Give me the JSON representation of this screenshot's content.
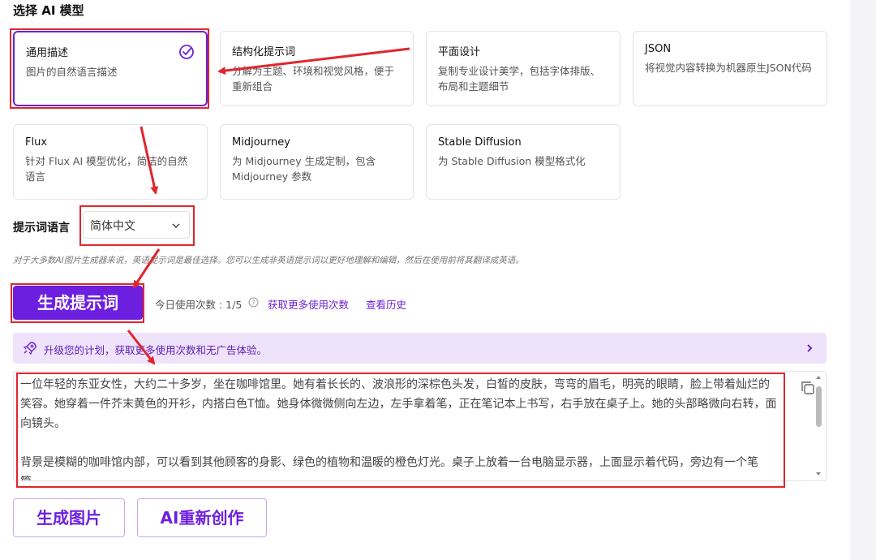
{
  "section": {
    "title": "选择 AI 模型"
  },
  "models": [
    {
      "title": "通用描述",
      "desc": "图片的自然语言描述"
    },
    {
      "title": "结构化提示词",
      "desc": "分解为主题、环境和视觉风格，便于重新组合"
    },
    {
      "title": "平面设计",
      "desc": "复制专业设计美学，包括字体排版、布局和主题细节"
    },
    {
      "title": "JSON",
      "desc": "将视觉内容转换为机器原生JSON代码"
    },
    {
      "title": "Flux",
      "desc": "针对 Flux AI 模型优化，简洁的自然语言"
    },
    {
      "title": "Midjourney",
      "desc": "为 Midjourney 生成定制，包含 Midjourney 参数"
    },
    {
      "title": "Stable Diffusion",
      "desc": "为 Stable Diffusion 模型格式化"
    }
  ],
  "language": {
    "label": "提示词语言",
    "selected": "简体中文"
  },
  "hint": "对于大多数AI图片生成器来说，英语提示词是最佳选择。您可以生成非英语提示词以更好地理解和编辑，然后在使用前将其翻译成英语。",
  "generate": {
    "button": "生成提示词",
    "usage": "今日使用次数 : 1/5",
    "more_link": "获取更多使用次数",
    "history_link": "查看历史"
  },
  "upgrade": {
    "text": "升级您的计划，获取更多使用次数和无广告体验。"
  },
  "output": {
    "paragraph1": "一位年轻的东亚女性，大约二十多岁，坐在咖啡馆里。她有着长长的、波浪形的深棕色头发，白皙的皮肤，弯弯的眉毛，明亮的眼睛，脸上带着灿烂的笑容。她穿着一件芥末黄色的开衫，内搭白色T恤。她身体微微侧向左边，左手拿着笔，正在笔记本上书写，右手放在桌子上。她的头部略微向右转，面向镜头。",
    "paragraph2": "背景是模糊的咖啡馆内部，可以看到其他顾客的身影、绿色的植物和温暖的橙色灯光。桌子上放着一台电脑显示器，上面显示着代码，旁边有一个笔筒。"
  },
  "actions": {
    "generate_image": "生成图片",
    "recreate": "AI重新创作"
  },
  "colors": {
    "accent": "#6d1fe0",
    "annotation": "#e0262d",
    "upgrade_bg": "#efe3fb"
  }
}
